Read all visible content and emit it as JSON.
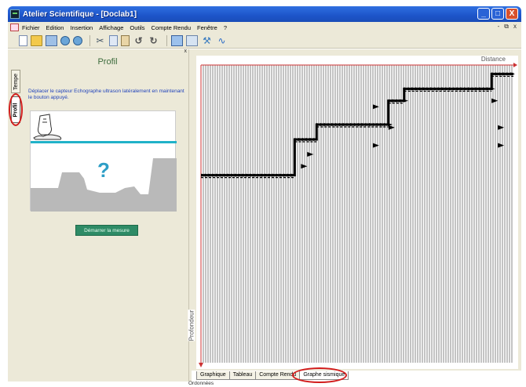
{
  "window": {
    "title": "Atelier Scientifique - [Doclab1]",
    "buttons": [
      "_",
      "□",
      "X"
    ]
  },
  "menu": {
    "items": [
      "Fichier",
      "Edition",
      "Insertion",
      "Affichage",
      "Outils",
      "Compte Rendu",
      "Fenêtre",
      "?"
    ],
    "mdi_buttons": [
      "-",
      "⧉",
      "x"
    ]
  },
  "toolbar": {
    "icons": [
      "new-icon",
      "open-icon",
      "save-icon",
      "graph-icon",
      "graph2-icon",
      "cut-icon",
      "copy-icon",
      "paste-icon",
      "undo-icon",
      "redo-icon",
      "screen-icon",
      "table-icon",
      "tool-icon",
      "wave-icon"
    ]
  },
  "left_panel": {
    "tabs": [
      "Tempe",
      "Profil"
    ],
    "title": "Profil",
    "instruction": "Déplacer le capteur Echographe ultrason latéralement en maintenant le bouton appuyé.",
    "question_mark": "?",
    "start_button": "Démarrer la mesure",
    "close": "x"
  },
  "chart": {
    "x_label": "Distance",
    "y_label": "Profondeur"
  },
  "bottom_tabs": {
    "items": [
      "Graphique",
      "Tableau",
      "Compte Rendu",
      "Graphe sismique"
    ],
    "active_index": 3
  },
  "status": {
    "text": "Ordonnées"
  },
  "colors": {
    "annotation": "#d21c1c",
    "title_bar": "#1d55c9",
    "start_button": "#2e8b66",
    "water_line": "#20b2c8"
  },
  "chart_data": {
    "type": "line",
    "xlabel": "Distance",
    "ylabel": "Profondeur",
    "profile_steps": [
      {
        "from": 0.0,
        "to": 0.3,
        "depth": 0.37
      },
      {
        "from": 0.3,
        "to": 0.37,
        "depth": 0.25
      },
      {
        "from": 0.37,
        "to": 0.6,
        "depth": 0.2
      },
      {
        "from": 0.6,
        "to": 0.65,
        "depth": 0.12
      },
      {
        "from": 0.65,
        "to": 0.93,
        "depth": 0.08
      },
      {
        "from": 0.93,
        "to": 1.0,
        "depth": 0.03
      }
    ]
  }
}
